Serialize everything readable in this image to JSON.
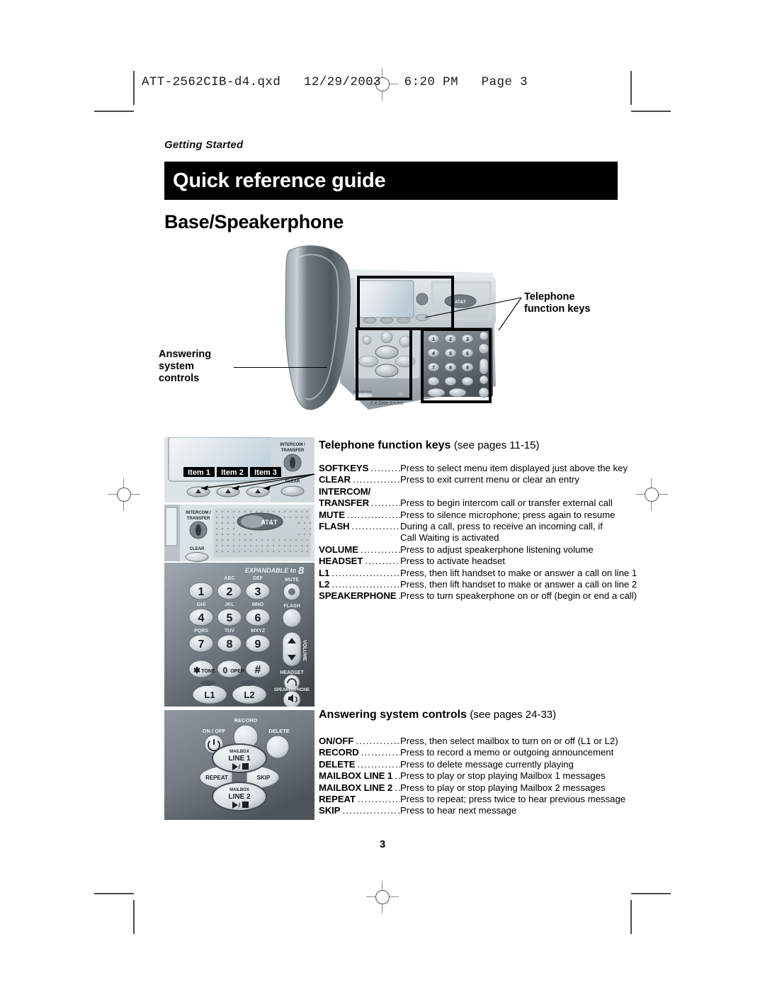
{
  "print_header": {
    "filename_line": "ATT-2562CIB-d4.qxd   12/29/2003   6:20 PM   Page 3"
  },
  "page": {
    "kicker": "Getting Started",
    "title": "Quick reference guide",
    "subtitle": "Base/Speakerphone",
    "page_number": "3"
  },
  "callouts": {
    "left": {
      "line1": "Answering",
      "line2": "system",
      "line3": "controls"
    },
    "right": {
      "line1": "Telephone",
      "line2": "function keys"
    }
  },
  "sections": [
    {
      "id": "telephone-function-keys",
      "heading": "Telephone function keys",
      "note": "(see pages 11-15)",
      "rows": [
        {
          "label": "SOFTKEYS",
          "desc": "Press to select menu item displayed just above the key"
        },
        {
          "label": "CLEAR",
          "desc": "Press to exit current menu or clear an entry"
        },
        {
          "label": "INTERCOM/",
          "desc": "",
          "label_only": true
        },
        {
          "label": "TRANSFER",
          "desc": "Press to begin intercom call or transfer external call"
        },
        {
          "label": "MUTE",
          "desc": "Press to silence microphone; press again to resume"
        },
        {
          "label": "FLASH",
          "desc": "During a call, press to receive an incoming call, if",
          "cont": "Call Waiting is activated"
        },
        {
          "label": "VOLUME",
          "desc": "Press to adjust speakerphone listening volume"
        },
        {
          "label": "HEADSET",
          "desc": "Press to activate headset"
        },
        {
          "label": "L1",
          "desc": "Press, then lift handset to make or answer a call on line 1"
        },
        {
          "label": "L2",
          "desc": "Press, then lift handset to make or answer a call on line 2"
        },
        {
          "label": "SPEAKERPHONE",
          "desc": "Press to turn speakerphone on or off (begin or end a call)"
        }
      ]
    },
    {
      "id": "answering-system-controls",
      "heading": "Answering system controls",
      "note": "(see pages 24-33)",
      "rows": [
        {
          "label": "ON/OFF",
          "desc": "Press, then select mailbox to turn on or off (L1 or L2)"
        },
        {
          "label": "RECORD",
          "desc": "Press to record a memo or outgoing announcement"
        },
        {
          "label": "DELETE",
          "desc": "Press to delete message currently playing"
        },
        {
          "label": "MAILBOX LINE 1",
          "desc": "Press to play or stop playing Mailbox 1 messages"
        },
        {
          "label": "MAILBOX LINE 2",
          "desc": "Press to play or stop playing Mailbox 2 messages"
        },
        {
          "label": "REPEAT",
          "desc": "Press to repeat; press twice to hear previous message"
        },
        {
          "label": "SKIP",
          "desc": "Press to hear next message"
        }
      ]
    }
  ],
  "artwork": {
    "softkey_detail": {
      "item_labels": [
        "Item 1",
        "Item 2",
        "Item 3"
      ],
      "intercom_label_line1": "INTERCOM /",
      "intercom_label_line2": "TRANSFER",
      "clear_label": "CLEAR"
    },
    "keypad_detail": {
      "brand": "AT&T",
      "expandable_text": "EXPANDABLE to",
      "expandable_number": "8",
      "intercom_label_line1": "INTERCOM /",
      "intercom_label_line2": "TRANSFER",
      "clear_label": "CLEAR",
      "keys": [
        {
          "digit": "1",
          "letters": ""
        },
        {
          "digit": "2",
          "letters": "ABC"
        },
        {
          "digit": "3",
          "letters": "DEF"
        },
        {
          "digit": "4",
          "letters": "GHI"
        },
        {
          "digit": "5",
          "letters": "JKL"
        },
        {
          "digit": "6",
          "letters": "MNO"
        },
        {
          "digit": "7",
          "letters": "PQRS"
        },
        {
          "digit": "8",
          "letters": "TUV"
        },
        {
          "digit": "9",
          "letters": "WXYZ"
        }
      ],
      "star_key": "TONE",
      "zero_key": "OPER",
      "pound_key": "#",
      "line_keys": [
        "L1",
        "L2"
      ],
      "side_keys": [
        "MUTE",
        "FLASH",
        "VOLUME",
        "HEADSET",
        "SPEAKERPHONE"
      ]
    },
    "answering_detail": {
      "on_off": "ON / OFF",
      "record": "RECORD",
      "delete": "DELETE",
      "mailbox": "MAILBOX",
      "line1": "LINE 1",
      "line2": "LINE 2",
      "repeat": "REPEAT",
      "skip": "SKIP"
    },
    "base_photo": {
      "brand": "AT&T",
      "band_text": "2.4 GHz   2-Line"
    }
  }
}
